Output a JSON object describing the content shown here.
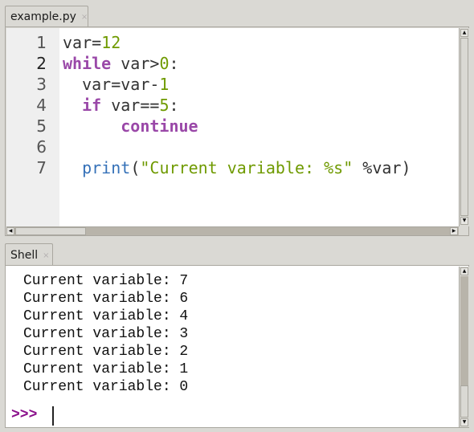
{
  "editor": {
    "tab_label": "example.py",
    "tab_close": "×",
    "current_line": 2,
    "line_numbers": [
      "1",
      "2",
      "3",
      "4",
      "5",
      "6",
      "7"
    ],
    "lines": [
      [
        {
          "t": "var=",
          "c": "plain"
        },
        {
          "t": "12",
          "c": "num"
        }
      ],
      [
        {
          "t": "while",
          "c": "kw"
        },
        {
          "t": " var>",
          "c": "plain"
        },
        {
          "t": "0",
          "c": "num"
        },
        {
          "t": ":",
          "c": "plain"
        }
      ],
      [
        {
          "t": "  var=var-",
          "c": "plain"
        },
        {
          "t": "1",
          "c": "num"
        }
      ],
      [
        {
          "t": "  ",
          "c": "plain"
        },
        {
          "t": "if",
          "c": "kw"
        },
        {
          "t": " var==",
          "c": "plain"
        },
        {
          "t": "5",
          "c": "num"
        },
        {
          "t": ":",
          "c": "plain"
        }
      ],
      [
        {
          "t": "      ",
          "c": "plain"
        },
        {
          "t": "continue",
          "c": "kw"
        }
      ],
      [],
      [
        {
          "t": "  ",
          "c": "plain"
        },
        {
          "t": "print",
          "c": "builtin"
        },
        {
          "t": "(",
          "c": "plain"
        },
        {
          "t": "\"Current variable: %s\"",
          "c": "str"
        },
        {
          "t": " %var)",
          "c": "plain"
        }
      ]
    ],
    "scrollbar_up": "▲",
    "scrollbar_down": "▼",
    "scrollbar_left": "◀",
    "scrollbar_right": "▶"
  },
  "shell": {
    "tab_label": "Shell",
    "tab_close": "×",
    "output": [
      "Current variable: 7",
      "Current variable: 6",
      "Current variable: 4",
      "Current variable: 3",
      "Current variable: 2",
      "Current variable: 1",
      "Current variable: 0"
    ],
    "prompt": ">>>",
    "scrollbar_up": "▲",
    "scrollbar_down": "▼"
  },
  "colors": {
    "keyword": "#9a48a8",
    "number": "#6f9a00",
    "string": "#6f9a00",
    "builtin": "#3571b8",
    "prompt": "#8a0f8a"
  }
}
